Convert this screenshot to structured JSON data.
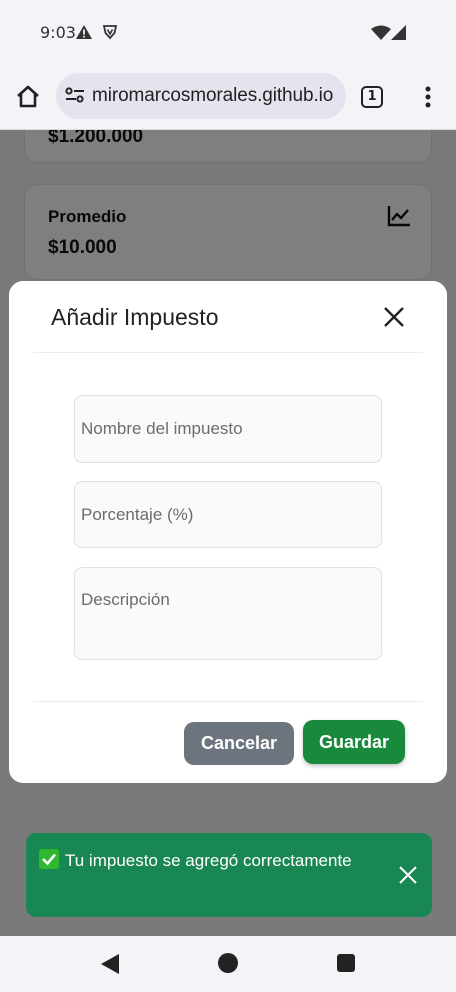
{
  "status_bar": {
    "time": "9:03",
    "icons": [
      "warning-icon",
      "shield-icon",
      "wifi-icon",
      "signal-icon"
    ]
  },
  "browser": {
    "url": "miromarcosmorales.github.io",
    "tab_count": "1",
    "icons": [
      "home-icon",
      "site-settings-icon",
      "more-vert-icon"
    ]
  },
  "page": {
    "top_card": {
      "amount": "$1.200.000"
    },
    "average_card": {
      "label": "Promedio",
      "amount": "$10.000",
      "icon": "chart-line-icon"
    }
  },
  "modal": {
    "title": "Añadir Impuesto",
    "fields": {
      "name_placeholder": "Nombre del impuesto",
      "percentage_placeholder": "Porcentaje (%)",
      "description_placeholder": "Descripción"
    },
    "buttons": {
      "cancel": "Cancelar",
      "save": "Guardar"
    }
  },
  "toast": {
    "message": "Tu impuesto se agregó correctamente",
    "icon": "check-mark-icon"
  },
  "colors": {
    "save_button": "#198a3c",
    "cancel_button": "#6c757d",
    "toast_bg": "#198754"
  }
}
